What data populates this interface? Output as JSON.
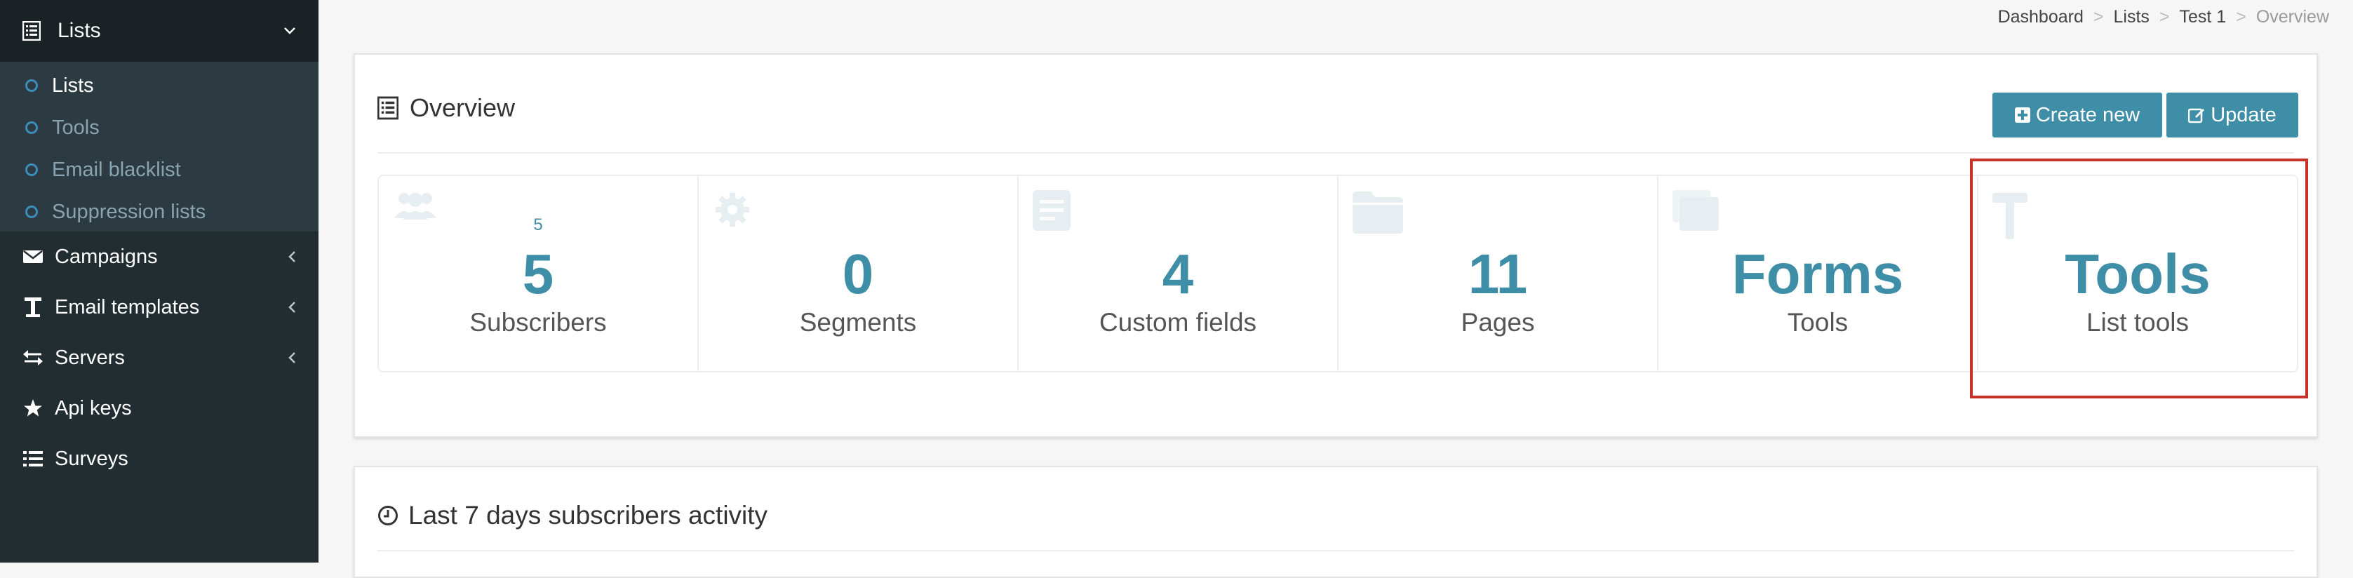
{
  "sidebar": {
    "header": {
      "label": "Lists",
      "icon": "list-icon"
    },
    "sub_items": [
      {
        "label": "Lists"
      },
      {
        "label": "Tools"
      },
      {
        "label": "Email blacklist"
      },
      {
        "label": "Suppression lists"
      }
    ],
    "items": [
      {
        "label": "Campaigns",
        "icon": "envelope-icon"
      },
      {
        "label": "Email templates",
        "icon": "text-icon"
      },
      {
        "label": "Servers",
        "icon": "exchange-icon"
      },
      {
        "label": "Api keys",
        "icon": "star-icon"
      },
      {
        "label": "Surveys",
        "icon": "list-icon"
      }
    ]
  },
  "breadcrumb": {
    "items": [
      "Dashboard",
      "Lists",
      "Test 1"
    ],
    "current": "Overview",
    "separator": ">"
  },
  "overview": {
    "title": "Overview",
    "create_label": "Create new",
    "update_label": "Update",
    "tiles": [
      {
        "small": "5",
        "big": "5",
        "label": "Subscribers",
        "icon": "users-icon"
      },
      {
        "small": "",
        "big": "0",
        "label": "Segments",
        "icon": "gear-icon"
      },
      {
        "small": "",
        "big": "4",
        "label": "Custom fields",
        "icon": "document-icon"
      },
      {
        "small": "",
        "big": "11",
        "label": "Pages",
        "icon": "folder-icon"
      },
      {
        "small": "",
        "big": "Forms",
        "label": "Tools",
        "icon": "copy-icon"
      },
      {
        "small": "",
        "big": "Tools",
        "label": "List tools",
        "icon": "hammer-icon"
      }
    ]
  },
  "activity": {
    "title": "Last 7 days subscribers activity",
    "icon": "clock-icon"
  },
  "colors": {
    "sidebar_bg": "#222d32",
    "accent": "#3e8ea8",
    "highlight": "#c9322a"
  }
}
